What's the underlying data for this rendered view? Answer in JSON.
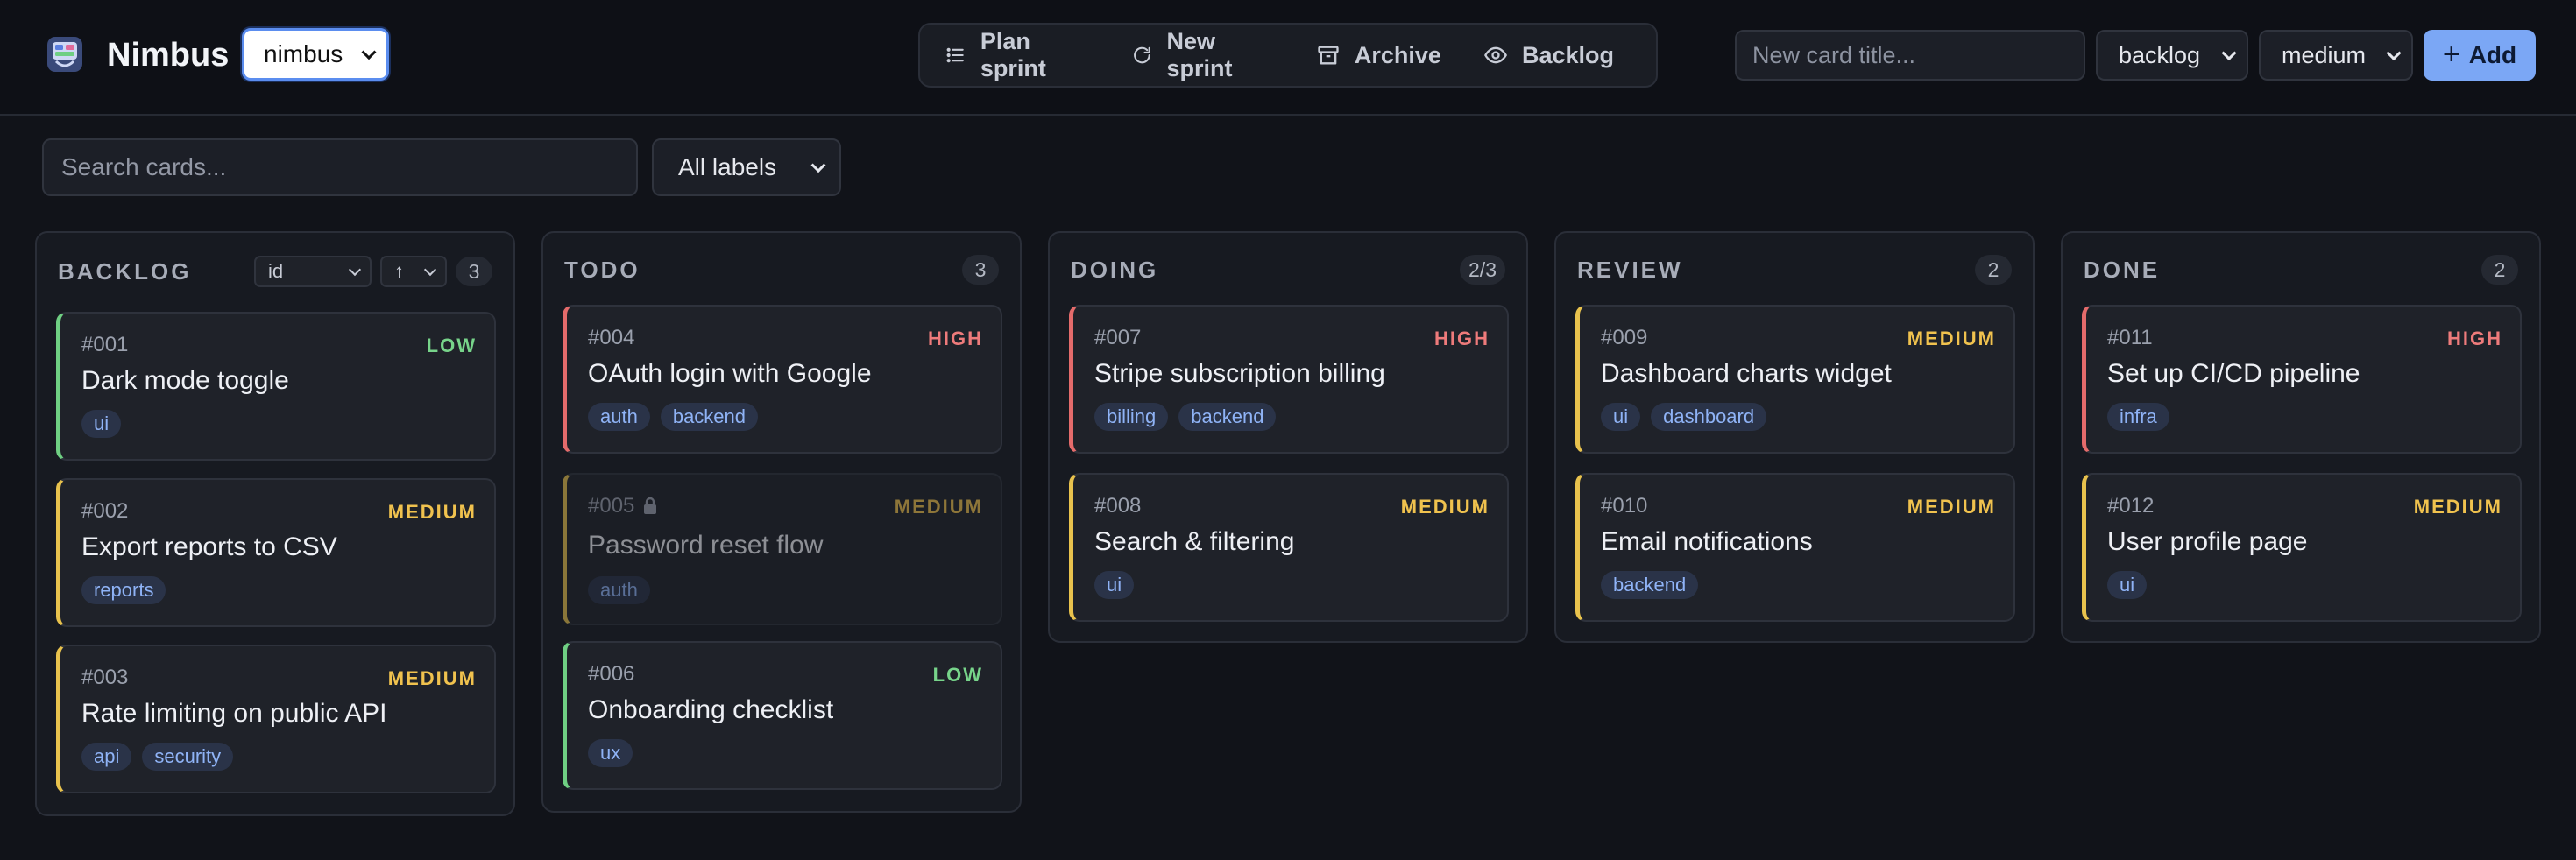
{
  "app": {
    "name": "Nimbus",
    "project": "nimbus"
  },
  "toolbar": {
    "plan_sprint": "Plan sprint",
    "new_sprint": "New sprint",
    "archive": "Archive",
    "backlog": "Backlog"
  },
  "new_card": {
    "placeholder": "New card title...",
    "status": "backlog",
    "priority": "medium",
    "add_label": "Add"
  },
  "filters": {
    "search_placeholder": "Search cards...",
    "labels": "All labels"
  },
  "colors": {
    "high": "#e46b6b",
    "medium": "#e8c24d",
    "low": "#6fcf83",
    "accent": "#7ba7f5"
  },
  "columns": [
    {
      "title": "BACKLOG",
      "count": "3",
      "sort_field": "id",
      "sort_dir": "↑",
      "cards": [
        {
          "id": "#001",
          "title": "Dark mode toggle",
          "priority": "LOW",
          "tags": [
            "ui"
          ]
        },
        {
          "id": "#002",
          "title": "Export reports to CSV",
          "priority": "MEDIUM",
          "tags": [
            "reports"
          ]
        },
        {
          "id": "#003",
          "title": "Rate limiting on public API",
          "priority": "MEDIUM",
          "tags": [
            "api",
            "security"
          ]
        }
      ]
    },
    {
      "title": "TODO",
      "count": "3",
      "cards": [
        {
          "id": "#004",
          "title": "OAuth login with Google",
          "priority": "HIGH",
          "tags": [
            "auth",
            "backend"
          ]
        },
        {
          "id": "#005",
          "title": "Password reset flow",
          "priority": "MEDIUM",
          "tags": [
            "auth"
          ],
          "locked": true
        },
        {
          "id": "#006",
          "title": "Onboarding checklist",
          "priority": "LOW",
          "tags": [
            "ux"
          ]
        }
      ]
    },
    {
      "title": "DOING",
      "count": "2/3",
      "cards": [
        {
          "id": "#007",
          "title": "Stripe subscription billing",
          "priority": "HIGH",
          "tags": [
            "billing",
            "backend"
          ]
        },
        {
          "id": "#008",
          "title": "Search & filtering",
          "priority": "MEDIUM",
          "tags": [
            "ui"
          ]
        }
      ]
    },
    {
      "title": "REVIEW",
      "count": "2",
      "cards": [
        {
          "id": "#009",
          "title": "Dashboard charts widget",
          "priority": "MEDIUM",
          "tags": [
            "ui",
            "dashboard"
          ]
        },
        {
          "id": "#010",
          "title": "Email notifications",
          "priority": "MEDIUM",
          "tags": [
            "backend"
          ]
        }
      ]
    },
    {
      "title": "DONE",
      "count": "2",
      "cards": [
        {
          "id": "#011",
          "title": "Set up CI/CD pipeline",
          "priority": "HIGH",
          "tags": [
            "infra"
          ]
        },
        {
          "id": "#012",
          "title": "User profile page",
          "priority": "MEDIUM",
          "tags": [
            "ui"
          ]
        }
      ]
    }
  ]
}
